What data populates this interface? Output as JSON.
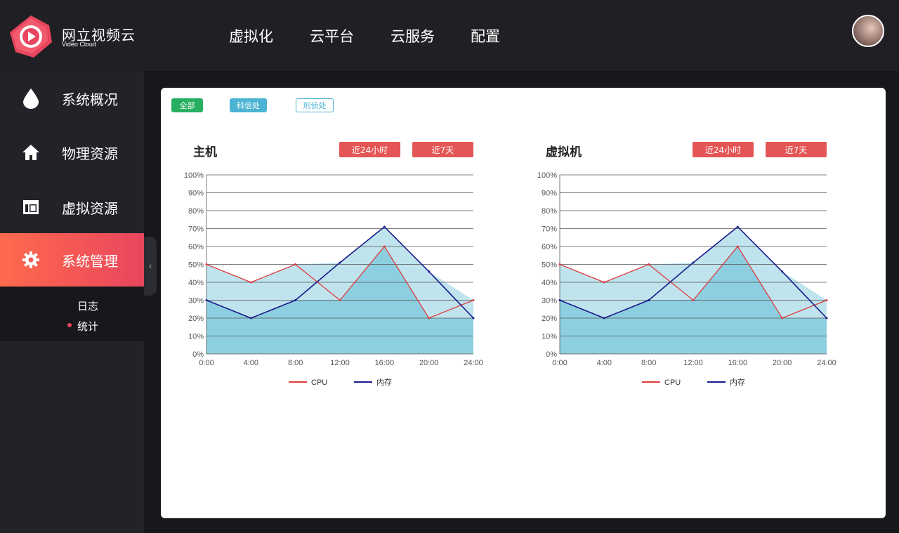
{
  "brand": {
    "name": "网立视频云",
    "sub": "Video Cloud"
  },
  "sidebar": {
    "items": [
      {
        "label": "系统概况",
        "icon": "drop-icon"
      },
      {
        "label": "物理资源",
        "icon": "home-icon"
      },
      {
        "label": "虚拟资源",
        "icon": "window-icon"
      },
      {
        "label": "系统管理",
        "icon": "gear-icon",
        "active": true
      }
    ],
    "submenu": [
      {
        "label": "日志"
      },
      {
        "label": "统计",
        "selected": true
      }
    ]
  },
  "topnav": {
    "items": [
      "虚拟化",
      "云平台",
      "云服务",
      "配置"
    ]
  },
  "filters": {
    "items": [
      "全部",
      "科信处",
      "刑侦处"
    ]
  },
  "colors": {
    "accent": "#e8465e",
    "cpu": "#e03a3a",
    "memory": "#1a1a8c",
    "area_back": "#bfe4ee",
    "area_front": "#8dcfe1"
  },
  "chart_data": [
    {
      "type": "area",
      "title": "主机",
      "buttons": [
        "近24小时",
        "近7天"
      ],
      "x": [
        "0:00",
        "4:00",
        "8:00",
        "12:00",
        "16:00",
        "20:00",
        "24:00"
      ],
      "y_ticks": [
        "100%",
        "90%",
        "80%",
        "70%",
        "60%",
        "50%",
        "40%",
        "30%",
        "20%",
        "10%",
        "0%"
      ],
      "ylim": [
        0,
        100
      ],
      "grid": true,
      "legend": "bottom",
      "series": [
        {
          "name": "CPU",
          "values": [
            50,
            40,
            50,
            30,
            60,
            20,
            30
          ]
        },
        {
          "name": "内存",
          "values": [
            30,
            20,
            30,
            51,
            71,
            46,
            20
          ]
        }
      ]
    },
    {
      "type": "area",
      "title": "虚拟机",
      "buttons": [
        "近24小时",
        "近7天"
      ],
      "x": [
        "0:00",
        "4:00",
        "8:00",
        "12:00",
        "16:00",
        "20:00",
        "24:00"
      ],
      "y_ticks": [
        "100%",
        "90%",
        "80%",
        "70%",
        "60%",
        "50%",
        "40%",
        "30%",
        "20%",
        "10%",
        "0%"
      ],
      "ylim": [
        0,
        100
      ],
      "grid": true,
      "legend": "bottom",
      "series": [
        {
          "name": "CPU",
          "values": [
            50,
            40,
            50,
            30,
            60,
            20,
            30
          ]
        },
        {
          "name": "内存",
          "values": [
            30,
            20,
            30,
            51,
            71,
            46,
            20
          ]
        }
      ]
    }
  ]
}
